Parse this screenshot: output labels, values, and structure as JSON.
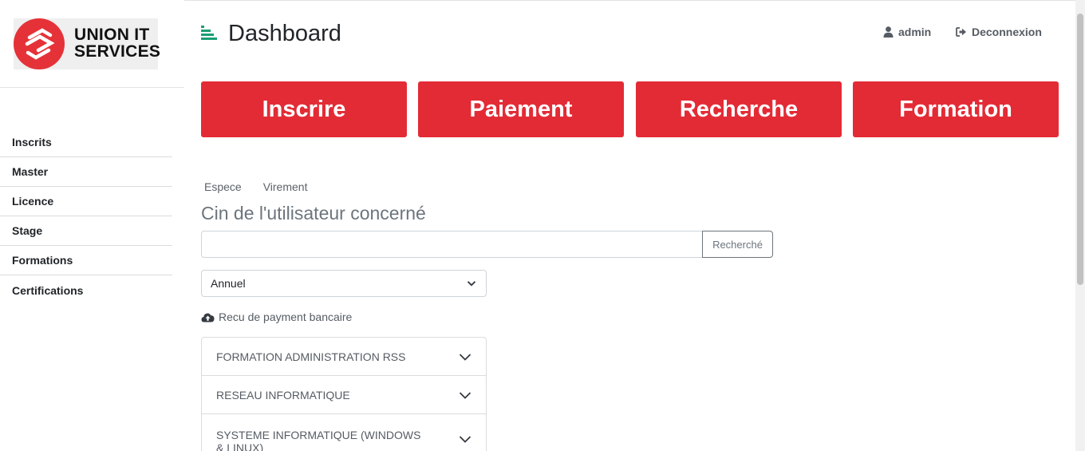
{
  "brand": {
    "logo_line1": "UNION IT",
    "logo_line2": "SERVICES",
    "accent_color": "#e53238"
  },
  "sidebar": {
    "items": [
      {
        "label": "Inscrits"
      },
      {
        "label": "Master"
      },
      {
        "label": "Licence"
      },
      {
        "label": "Stage"
      },
      {
        "label": "Formations"
      },
      {
        "label": "Certifications"
      }
    ]
  },
  "header": {
    "title": "Dashboard",
    "menu_icon": "list-icon",
    "user_label": "admin",
    "logout_label": "Deconnexion"
  },
  "tiles": [
    {
      "label": "Inscrire"
    },
    {
      "label": "Paiement"
    },
    {
      "label": "Recherche"
    },
    {
      "label": "Formation"
    }
  ],
  "tile_color": "#e32b36",
  "payment": {
    "tabs": [
      "Espece",
      "Virement"
    ],
    "section_title": "Cin de l'utilisateur concerné",
    "search_value": "",
    "search_button": "Recherché",
    "period_selected": "Annuel",
    "upload_label": "Recu de payment bancaire"
  },
  "formations": [
    {
      "label": "FORMATION ADMINISTRATION RSS"
    },
    {
      "label": "RESEAU INFORMATIQUE"
    },
    {
      "label": "SYSTEME INFORMATIQUE (WINDOWS & LINUX)"
    }
  ]
}
